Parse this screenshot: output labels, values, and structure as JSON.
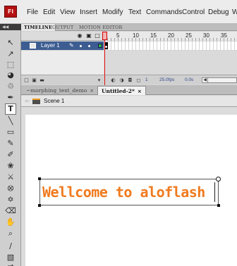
{
  "app": {
    "logo": "Fl",
    "menu": [
      "File",
      "Edit",
      "View",
      "Insert",
      "Modify",
      "Text",
      "Commands",
      "Control",
      "Debug",
      "W"
    ]
  },
  "tools_panel": {
    "grip": "◀◀",
    "tools": [
      {
        "name": "selection-tool-icon",
        "glyph": "↖"
      },
      {
        "name": "subselection-tool-icon",
        "glyph": "↗"
      },
      {
        "name": "free-transform-tool-icon",
        "glyph": "⬚"
      },
      {
        "name": "3d-rotation-tool-icon",
        "glyph": "◕"
      },
      {
        "name": "lasso-tool-icon",
        "glyph": "♲"
      },
      {
        "name": "pen-tool-icon",
        "glyph": "✒"
      },
      {
        "name": "text-tool-icon",
        "glyph": "T"
      },
      {
        "name": "line-tool-icon",
        "glyph": "╲"
      },
      {
        "name": "rectangle-tool-icon",
        "glyph": "▭"
      },
      {
        "name": "pencil-tool-icon",
        "glyph": "✎"
      },
      {
        "name": "brush-tool-icon",
        "glyph": "✐"
      },
      {
        "name": "deco-tool-icon",
        "glyph": "❀"
      },
      {
        "name": "bone-tool-icon",
        "glyph": "⚔"
      },
      {
        "name": "paint-bucket-tool-icon",
        "glyph": "⭙"
      },
      {
        "name": "eyedropper-tool-icon",
        "glyph": "✡"
      },
      {
        "name": "eraser-tool-icon",
        "glyph": "⌫"
      },
      {
        "name": "hand-tool-icon",
        "glyph": "✋"
      },
      {
        "name": "zoom-tool-icon",
        "glyph": "⌕"
      },
      {
        "name": "stroke-color-icon",
        "glyph": "∕"
      },
      {
        "name": "fill-color-icon",
        "glyph": "▧"
      },
      {
        "name": "swap-colors-icon",
        "glyph": "⇄"
      }
    ]
  },
  "timeline": {
    "tabs": [
      "TIMELINE",
      "OUTPUT",
      "MOTION EDITOR"
    ],
    "header_icons": [
      "eye-icon",
      "lock-icon",
      "outline-icon"
    ],
    "frame_numbers": [
      "1",
      "5",
      "10",
      "15",
      "20",
      "25",
      "30",
      "35"
    ],
    "layers": [
      {
        "name": "Layer 1"
      }
    ],
    "footer": {
      "frame": "1",
      "fps": "25.0fps",
      "time": "0.0s"
    },
    "playhead_frame": 1
  },
  "document_tabs": [
    {
      "label": "~morphing_text_demo",
      "close": "×",
      "active": false
    },
    {
      "label": "Untitled-2*",
      "close": "×",
      "active": true
    }
  ],
  "edit_bar": {
    "scene": "Scene 1"
  },
  "stage": {
    "text": "Wellcome to aloflash",
    "text_color": "#f07a1e"
  }
}
